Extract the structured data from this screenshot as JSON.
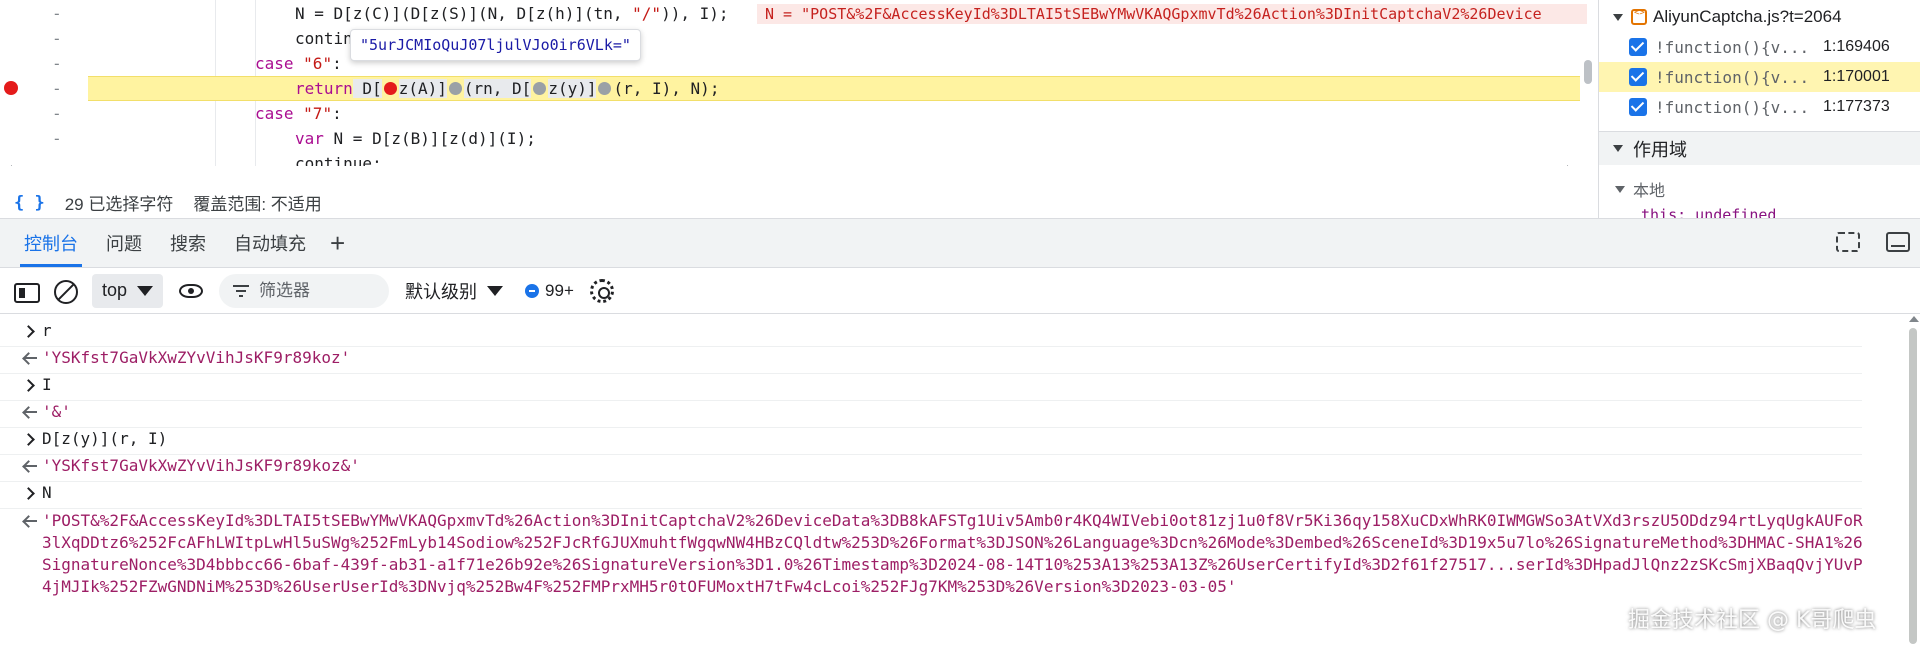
{
  "editor": {
    "lines": [
      {
        "prefix": "N = D[z(C)](D[z(S)](N, D[z(h)](tn, ",
        "str": "\"/\"",
        "suffix": ")), I);"
      },
      {
        "text": "contin"
      },
      {
        "kw": "case",
        "str": "\"6\"",
        "suffix": ":"
      },
      {
        "kw": "return",
        "rest_a": " D[",
        "rest_b": "z(A)]",
        "rest_c": "(rn, D[",
        "rest_d": "z(y)]",
        "rest_e": "(r, I), N);"
      },
      {
        "kw": "case",
        "str": "\"7\"",
        "suffix": ":"
      },
      {
        "kw": "var",
        "rest": " N = D[z(B)][z(d)](I);"
      },
      {
        "text": "continue;"
      }
    ],
    "dash": "-",
    "inline_value": "N = \"POST&%2F&AccessKeyId%3DLTAI5tSEBwYMwVKAQGpxmvTd%26Action%3DInitCaptchaV2%26Device",
    "tooltip": "\"5urJCMIoQuJ07ljulVJo0ir6VLk=\""
  },
  "status_bar": {
    "braces": "{ }",
    "selection": "29 已选择字符",
    "coverage": "覆盖范围: 不适用"
  },
  "right_pane": {
    "file": "AliyunCaptcha.js?t=2064",
    "frames": [
      {
        "fn": "!function(){v...",
        "loc": "1:169406"
      },
      {
        "fn": "!function(){v...",
        "loc": "1:170001"
      },
      {
        "fn": "!function(){v...",
        "loc": "1:177373"
      }
    ],
    "scope_header": "作用域",
    "local_header": "本地",
    "this_row": "this: undefined"
  },
  "drawer": {
    "tabs": [
      "控制台",
      "问题",
      "搜索",
      "自动填充"
    ],
    "active_tab": 0,
    "plus": "+"
  },
  "toolbar": {
    "context": "top",
    "filter_placeholder": "筛选器",
    "level": "默认级别",
    "message_count": "99+"
  },
  "console": {
    "entries": [
      {
        "type": "input",
        "text": "r"
      },
      {
        "type": "result",
        "text": "'YSKfst7GaVkXwZYvVihJsKF9r89koz'"
      },
      {
        "type": "input",
        "text": "I"
      },
      {
        "type": "result",
        "text": "'&'"
      },
      {
        "type": "input",
        "text": "D[z(y)](r, I)"
      },
      {
        "type": "result",
        "text": "'YSKfst7GaVkXwZYvVihJsKF9r89koz&'"
      },
      {
        "type": "input",
        "text": "N"
      },
      {
        "type": "result",
        "text": "'POST&%2F&AccessKeyId%3DLTAI5tSEBwYMwVKAQGpxmvTd%26Action%3DInitCaptchaV2%26DeviceData%3DB8kAFSTg1Uiv5Amb0r4KQ4WIVebi0ot81zj1u0f8Vr5Ki36qy158XuCDxWhRK0IWMGWSo3AtVXd3rszU5ODdz94rtLyqUgkAUFoR3lXqDDtz6%252FcAFhLWItpLwHl5uSWg%252FmLyb14Sodiow%252FJcRfGJUXmuhtfWgqwNW4HBzCQldtw%253D%26Format%3DJSON%26Language%3Dcn%26Mode%3Dembed%26SceneId%3D19x5u7lo%26SignatureMethod%3DHMAC-SHA1%26SignatureNonce%3D4bbbcc66-6baf-439f-ab31-a1f71e26b92e%26SignatureVersion%3D1.0%26Timestamp%3D2024-08-14T10%253A13%253A13Z%26UserCertifyId%3D2f61f27517...serId%3DHpadJlQnz2zSKcSmjXBaqQvjYUvP4jMJIk%252FZwGNDNiM%253D%26UserUserId%3DNvjq%252Bw4F%252FMPrxMH5r0tOFUMoxtH7tFw4cLcoi%252FJg7KM%253D%26Version%3D2023-03-05'"
      }
    ]
  },
  "watermark": "掘金技术社区 @ K哥爬虫",
  "colors": {
    "accent": "#1a73e8",
    "breakpoint": "#e41b1b",
    "execution_line": "#fff5b1",
    "string_result": "#9d1e65",
    "keyword": "#aa0d91"
  }
}
